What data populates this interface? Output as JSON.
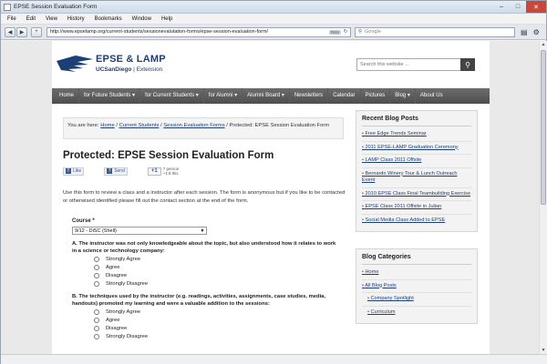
{
  "window": {
    "title": "EPSE Session Evaluation Form"
  },
  "menubar": {
    "items": [
      "File",
      "Edit",
      "View",
      "History",
      "Bookmarks",
      "Window",
      "Help"
    ]
  },
  "browser": {
    "url": "http://www.epselamp.org/current-students/sessionevalutation-forms/epse-session-evaluation-form/",
    "rss_label": "RSS",
    "search_placeholder": "Google"
  },
  "site": {
    "logo_main": "EPSE & LAMP",
    "logo_org": "UCSanDiego",
    "logo_unit": "Extension",
    "search_placeholder": "Search this website ..."
  },
  "nav": [
    "Home",
    "for Future Students ▾",
    "for Current Students ▾",
    "for Alumni ▾",
    "Alumni Board ▾",
    "Newsletters",
    "Calendar",
    "Pictures",
    "Blog ▾",
    "About Us"
  ],
  "breadcrumb": {
    "prefix": "You are here:",
    "home": "Home",
    "sep1": "/",
    "current_students": "Current Students",
    "sep2": "/",
    "session_forms": "Session Evaluation Forms",
    "tail": "/ Protected: EPSE Session Evaluation Form"
  },
  "page": {
    "title": "Protected: EPSE Session Evaluation Form",
    "like": "Like",
    "send": "Send",
    "plus": "+1",
    "plus_count": "7 person +1'd this",
    "intro": "Use this form to review a class and a instructor after each session. The form is anonymous but if you like to be contacted or otherwised identified please fill out the contact section at the end of the form."
  },
  "form": {
    "course_label": "Course *",
    "course_value": "9/12 - DiSC (Shell)",
    "question_a": "A. The instructor was not only knowledgeable about the topic, but also understood how it relates to work in a science or technology company:",
    "question_b": "B. The techniques used by the instructor (e.g. readings, activities, assignments, case studies, media, handouts) promoted my learning and were a valuable addition to the sessions:",
    "options": [
      "Strongly Agree",
      "Agree",
      "Disagree",
      "Strongly Disagree"
    ]
  },
  "sidebar": {
    "recent_title": "Recent Blog Posts",
    "recent": [
      "Free Edge Trends Seminar",
      "2011 EPSE-LAMP Graduation Ceremony",
      "LAMP Class 2011 Offsite",
      "Bernardo Winery Tour & Lunch Outreach Event",
      "2010 EPSE Class Final Teambuilding Exercise",
      "EPSE Class 2011 Offsite in Julian",
      "Social Media Class Added to EPSE"
    ],
    "categories_title": "Blog Categories",
    "categories": [
      "Home",
      "All Blog Posts",
      "Company Spotlight",
      "Curriculum"
    ]
  }
}
